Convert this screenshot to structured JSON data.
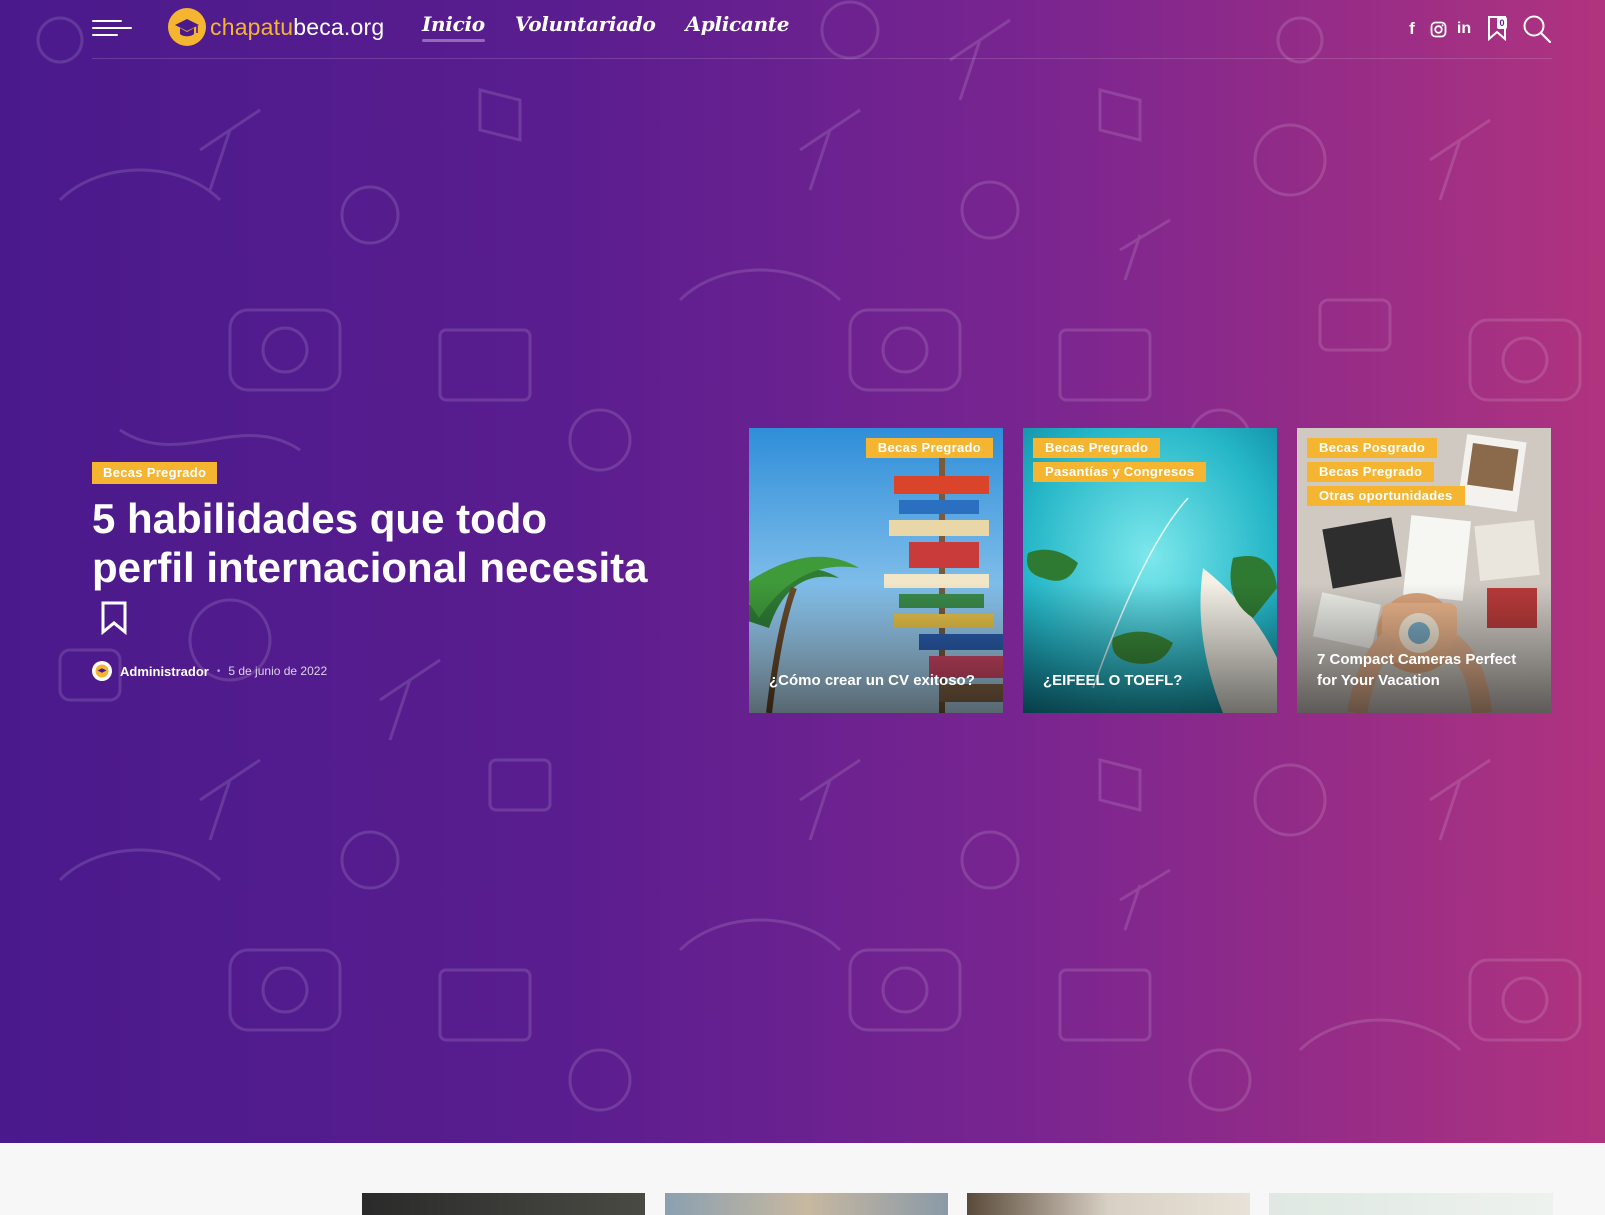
{
  "site": {
    "logo_part1": "chapatu",
    "logo_part2": "beca.org"
  },
  "nav": {
    "items": [
      {
        "label": "Inicio",
        "active": true
      },
      {
        "label": "Voluntariado",
        "active": false
      },
      {
        "label": "Aplicante",
        "active": false
      }
    ]
  },
  "header": {
    "facebook_glyph": "f",
    "linkedin_glyph": "in",
    "bookmark_count": "0"
  },
  "feature": {
    "category": "Becas Pregrado",
    "title": "5 habilidades que todo perfil internacional necesita",
    "author": "Administrador",
    "separator": "•",
    "date": "5 de junio de 2022"
  },
  "cards": [
    {
      "tags": [
        "Becas Pregrado"
      ],
      "title": "¿Cómo crear un CV exitoso?"
    },
    {
      "tags": [
        "Becas Pregrado",
        "Pasantías y Congresos"
      ],
      "title": "¿EIFEEL O TOEFL?"
    },
    {
      "tags": [
        "Becas Posgrado",
        "Becas Pregrado",
        "Otras oportunidades"
      ],
      "title": "7 Compact Cameras Perfect for Your Vacation"
    }
  ],
  "colors": {
    "accent": "#f6b531",
    "gradient_left": "#4a1a8c",
    "gradient_right": "#b0337f"
  },
  "icons": [
    "menu-icon",
    "facebook-icon",
    "instagram-icon",
    "linkedin-icon",
    "bookmark-icon",
    "search-icon"
  ]
}
